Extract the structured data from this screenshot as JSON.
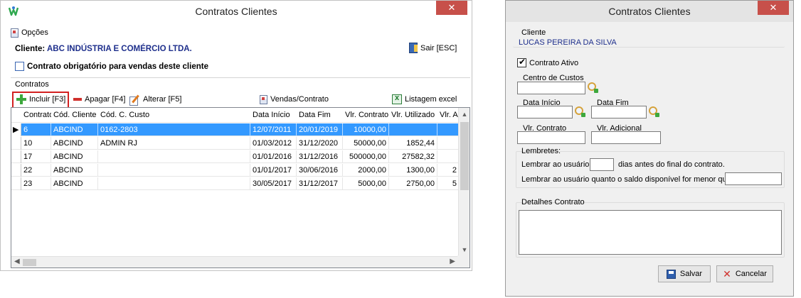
{
  "left_window": {
    "title": "Contratos Clientes",
    "close_label": "✕",
    "menu": {
      "options_label": "Opções"
    },
    "client_label": "Cliente:",
    "client_name": "ABC INDÚSTRIA E COMÉRCIO LTDA.",
    "exit_label": "Sair [ESC]",
    "mandatory_contract_label": "Contrato obrigatório para vendas deste cliente",
    "contracts_section_label": "Contratos",
    "toolbar": {
      "add_label": "Incluir [F3]",
      "delete_label": "Apagar [F4]",
      "edit_label": "Alterar [F5]",
      "sales_contract_label": "Vendas/Contrato",
      "excel_list_label": "Listagem excel"
    },
    "grid": {
      "columns": [
        "Contrato",
        "Cód. Cliente",
        "Cód. C. Custo",
        "Data Início",
        "Data Fim",
        "Vlr. Contrato",
        "Vlr. Utilizado",
        "Vlr. A"
      ],
      "rows": [
        {
          "indicator": "▶",
          "contrato": "6",
          "cliente": "ABCIND",
          "custo": "0162-2803",
          "inicio": "12/07/2011",
          "fim": "20/01/2019",
          "vlr_contrato": "10000,00",
          "vlr_utilizado": "",
          "vlr_a": ""
        },
        {
          "indicator": "",
          "contrato": "10",
          "cliente": "ABCIND",
          "custo": "ADMIN RJ",
          "inicio": "01/03/2012",
          "fim": "31/12/2020",
          "vlr_contrato": "50000,00",
          "vlr_utilizado": "1852,44",
          "vlr_a": ""
        },
        {
          "indicator": "",
          "contrato": "17",
          "cliente": "ABCIND",
          "custo": "",
          "inicio": "01/01/2016",
          "fim": "31/12/2016",
          "vlr_contrato": "500000,00",
          "vlr_utilizado": "27582,32",
          "vlr_a": ""
        },
        {
          "indicator": "",
          "contrato": "22",
          "cliente": "ABCIND",
          "custo": "",
          "inicio": "01/01/2017",
          "fim": "30/06/2016",
          "vlr_contrato": "2000,00",
          "vlr_utilizado": "1300,00",
          "vlr_a": "2"
        },
        {
          "indicator": "",
          "contrato": "23",
          "cliente": "ABCIND",
          "custo": "",
          "inicio": "30/05/2017",
          "fim": "31/12/2017",
          "vlr_contrato": "5000,00",
          "vlr_utilizado": "2750,00",
          "vlr_a": "5"
        }
      ]
    }
  },
  "right_window": {
    "title": "Contratos Clientes",
    "close_label": "✕",
    "client_group_label": "Cliente",
    "client_name": "LUCAS PEREIRA DA SILVA",
    "active_contract_label": "Contrato Ativo",
    "active_contract_checked": true,
    "cost_center_label": "Centro de Custos",
    "cost_center_value": "",
    "start_date_label": "Data Início",
    "start_date_value": "",
    "end_date_label": "Data Fim",
    "end_date_value": "",
    "contract_value_label": "Vlr. Contrato",
    "contract_value": "",
    "additional_value_label": "Vlr. Adicional",
    "additional_value": "",
    "reminders_label": "Lembretes:",
    "remind_days_prefix": "Lembrar ao usuário",
    "remind_days_value": "",
    "remind_days_suffix": "dias antes do final do contrato.",
    "remind_balance_label": "Lembrar ao usuário quanto o saldo disponível for menor que",
    "remind_balance_value": "",
    "details_label": "Detalhes Contrato",
    "details_value": "",
    "save_label": "Salvar",
    "cancel_label": "Cancelar"
  }
}
